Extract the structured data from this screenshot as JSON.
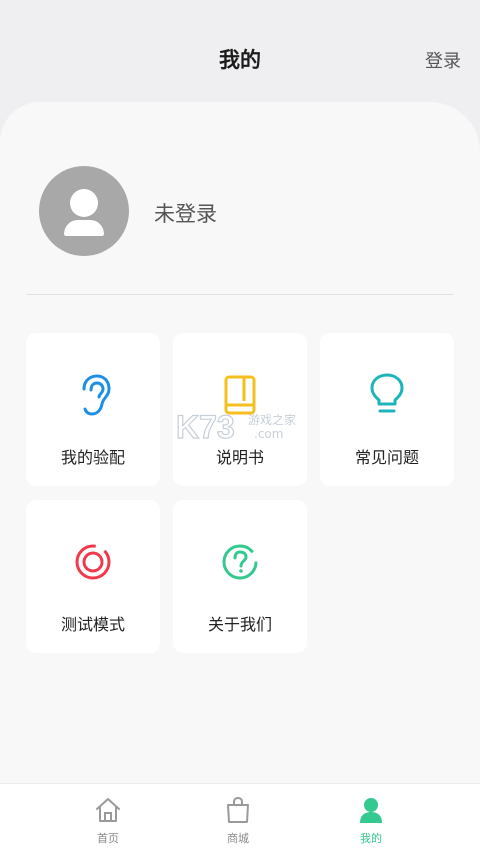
{
  "header": {
    "title": "我的",
    "login_label": "登录"
  },
  "profile": {
    "name": "未登录"
  },
  "menu": [
    {
      "label": "我的验配",
      "icon": "ear-icon",
      "color": "#1e8fe6"
    },
    {
      "label": "说明书",
      "icon": "book-icon",
      "color": "#f5bf1e"
    },
    {
      "label": "常见问题",
      "icon": "lightbulb-icon",
      "color": "#1fb4bb"
    },
    {
      "label": "测试模式",
      "icon": "target-rings-icon",
      "color": "#f03a4c"
    },
    {
      "label": "关于我们",
      "icon": "question-circle-icon",
      "color": "#34c98f"
    }
  ],
  "watermark": {
    "brand": "K73",
    "line1": "游戏之家",
    "line2": ".com"
  },
  "tabbar": {
    "active_color": "#34c98f",
    "items": [
      {
        "label": "首页",
        "icon": "home-icon",
        "active": false
      },
      {
        "label": "商城",
        "icon": "shopping-bag-icon",
        "active": false
      },
      {
        "label": "我的",
        "icon": "person-icon",
        "active": true
      }
    ]
  }
}
